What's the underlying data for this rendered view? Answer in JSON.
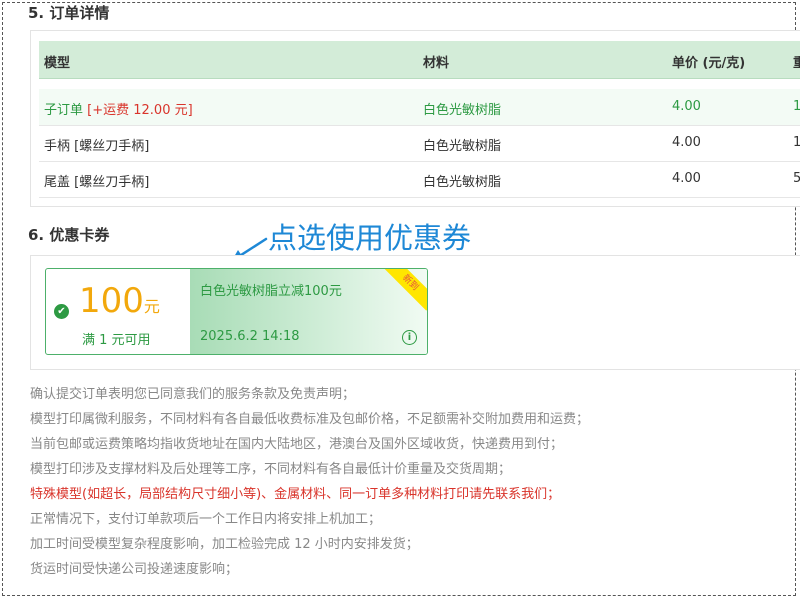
{
  "sections": {
    "order_title": "5. 订单详情",
    "coupon_title": "6. 优惠卡券"
  },
  "table": {
    "headers": [
      "模型",
      "材料",
      "单价 (元/克)",
      "重"
    ],
    "rows": [
      {
        "model": "子订单",
        "fee": "[+运费 12.00 元]",
        "material": "白色光敏树脂",
        "price": "4.00",
        "extra": "1"
      },
      {
        "model": "手柄 [螺丝刀手柄]",
        "fee": "",
        "material": "白色光敏树脂",
        "price": "4.00",
        "extra": "1"
      },
      {
        "model": "尾盖 [螺丝刀手柄]",
        "fee": "",
        "material": "白色光敏树脂",
        "price": "4.00",
        "extra": "5"
      }
    ]
  },
  "coupon": {
    "amount": "100",
    "unit": "元",
    "condition": "满 1 元可用",
    "description": "白色光敏树脂立减100元",
    "date": "2025.6.2 14:18",
    "badge": "新到",
    "info_symbol": "i"
  },
  "annotation": "点选使用优惠券",
  "notes": [
    "确认提交订单表明您已同意我们的服务条款及免责声明；",
    "模型打印属微利服务，不同材料有各自最低收费标准及包邮价格，不足额需补交附加费用和运费；",
    "当前包邮或运费策略均指收货地址在国内大陆地区，港澳台及国外区域收货，快递费用到付；",
    "模型打印涉及支撑材料及后处理等工序，不同材料有各自最低计价重量及交货周期；",
    "特殊模型(如超长，局部结构尺寸细小等)、金属材料、同一订单多种材料打印请先联系我们；",
    "正常情况下，支付订单款项后一个工作日内将安排上机加工；",
    "加工时间受模型复杂程度影响，加工检验完成 12 小时内安排发货；",
    "货运时间受快递公司投递速度影响；"
  ],
  "colors": {
    "accent_green": "#2d9a43",
    "fee_red": "#d9342b",
    "coupon_amount": "#f2a80c",
    "annotation_blue": "#1e88d6"
  }
}
